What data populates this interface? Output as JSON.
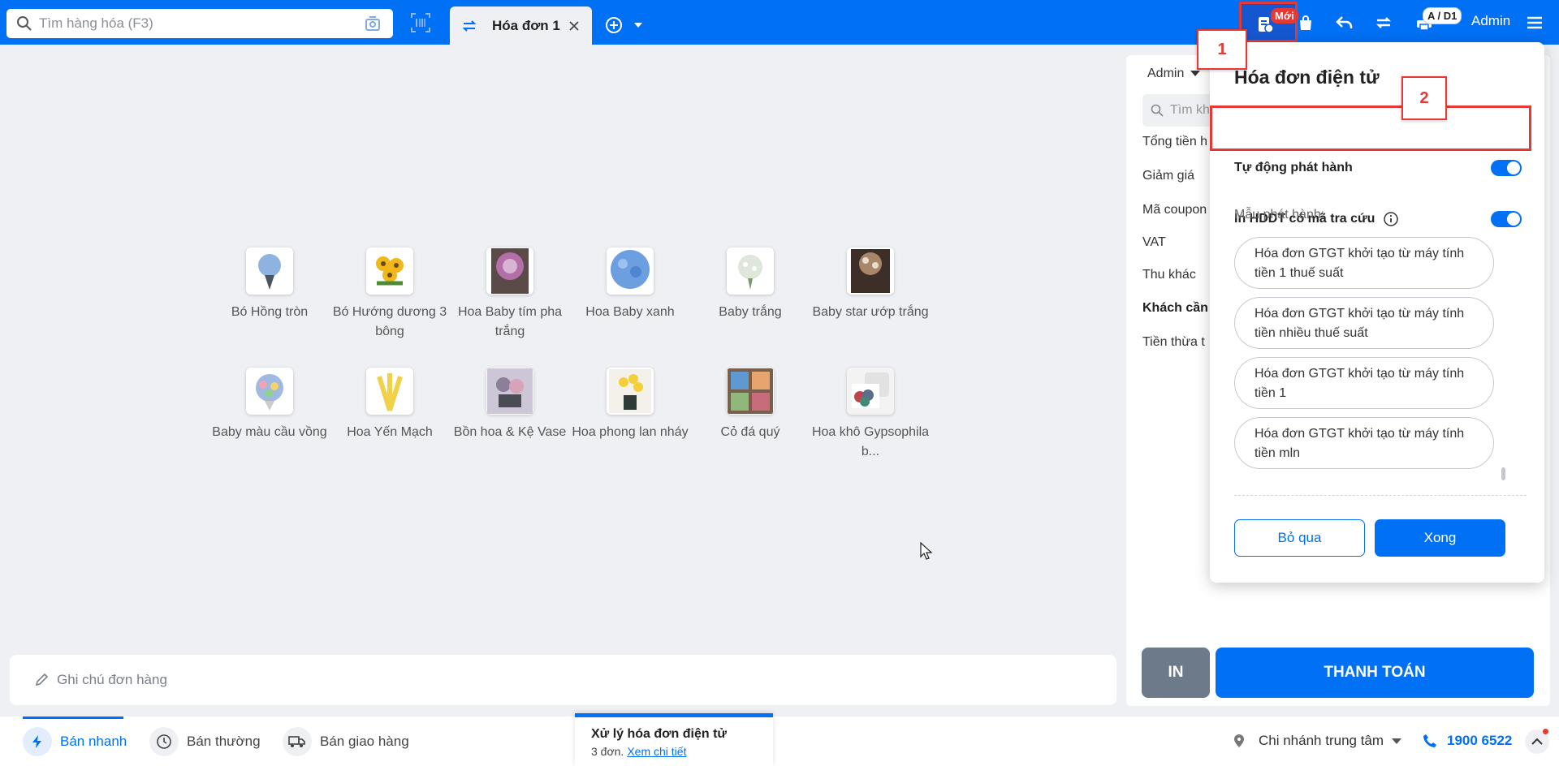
{
  "header": {
    "search_placeholder": "Tìm hàng hóa (F3)",
    "tab_label": "Hóa đơn 1",
    "einvoice_badge": "Mới",
    "printer_badge": "A / D1",
    "user_name": "Admin"
  },
  "products": [
    {
      "name": "Bó Hồng tròn",
      "color": "#8fb3e0"
    },
    {
      "name": "Bó Hướng dương 3 bông",
      "color": "#f0b81c"
    },
    {
      "name": "Hoa Baby tím pha trắng",
      "color": "#b36fa8"
    },
    {
      "name": "Hoa Baby xanh",
      "color": "#6c9fe0"
    },
    {
      "name": "Baby trắng",
      "color": "#dfe6dc"
    },
    {
      "name": "Baby star ướp trắng",
      "color": "#a8866a"
    },
    {
      "name": "Baby màu cầu vồng",
      "color": "#9fb9e0"
    },
    {
      "name": "Hoa Yến Mạch",
      "color": "#f2d14a"
    },
    {
      "name": "Bồn hoa & Kệ Vase",
      "color": "#8d7e9a"
    },
    {
      "name": "Hoa phong lan nháy",
      "color": "#f3d03a"
    },
    {
      "name": "Cỏ đá quý",
      "color": "#5e9ad0"
    },
    {
      "name": "Hoa khô Gypsophila b...",
      "color": "#5a6f8a"
    }
  ],
  "note": {
    "placeholder": "Ghi chú đơn hàng"
  },
  "right_panel": {
    "seller": "Admin",
    "customer_search": "Tìm kh",
    "rows": [
      "Tổng tiền h",
      "Giảm giá",
      "Mã coupon",
      "VAT",
      "Thu khác",
      "Khách cần",
      "Tiền thừa t"
    ],
    "print_label": "IN",
    "pay_label": "THANH TOÁN"
  },
  "einvoice_popup": {
    "title": "Hóa đơn điện tử",
    "auto_issue_label": "Tự động phát hành",
    "print_lookup_label": "In HDDT có mã tra cứu",
    "template_label": "Mẫu phát hành:",
    "templates": [
      "Hóa đơn GTGT khởi tạo từ máy tính tiền 1 thuế suất",
      "Hóa đơn GTGT khởi tạo từ máy tính tiền nhiều thuế suất",
      "Hóa đơn GTGT khởi tạo từ máy tính tiền 1",
      "Hóa đơn GTGT khởi tạo từ máy tính tiền mln"
    ],
    "skip_label": "Bỏ qua",
    "done_label": "Xong"
  },
  "callouts": {
    "one": "1",
    "two": "2"
  },
  "bottom_bar": {
    "modes": [
      "Bán nhanh",
      "Bán thường",
      "Bán giao hàng"
    ],
    "processing_title": "Xử lý hóa đơn điện tử",
    "processing_count": "3 đơn.",
    "processing_link": "Xem chi tiết",
    "branch": "Chi nhánh trung tâm",
    "hotline": "1900 6522"
  },
  "colors": {
    "brand": "#0070f4",
    "annotation": "#e53935"
  }
}
